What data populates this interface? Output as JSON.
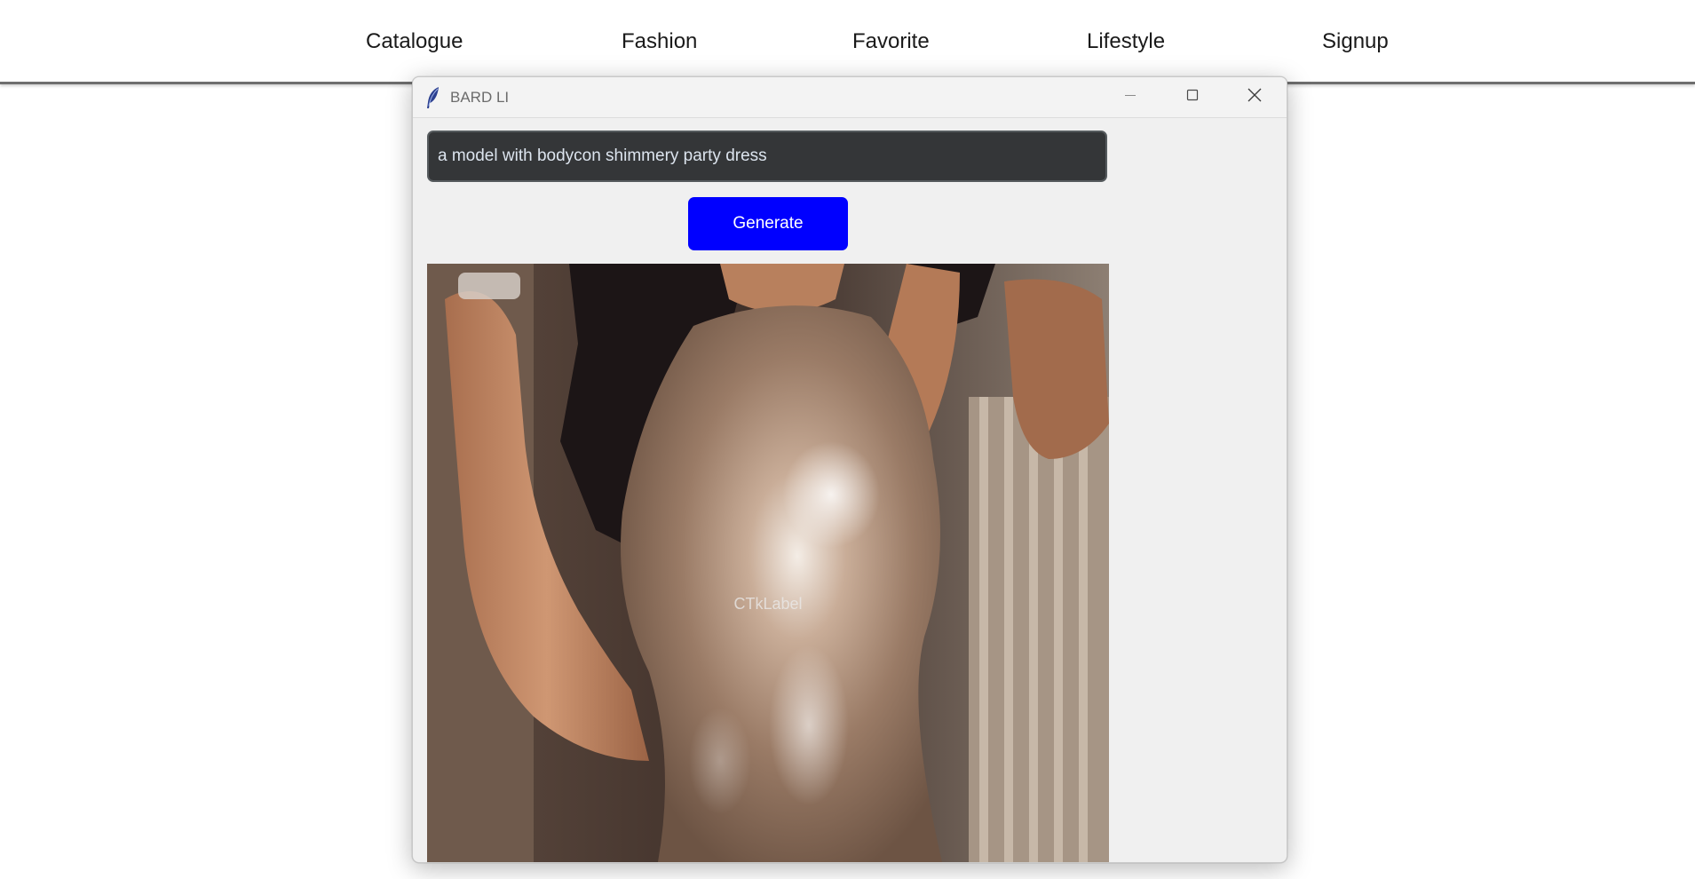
{
  "nav": {
    "items": [
      {
        "label": "Catalogue"
      },
      {
        "label": "Fashion"
      },
      {
        "label": "Favorite"
      },
      {
        "label": "Lifestyle"
      },
      {
        "label": "Signup"
      }
    ]
  },
  "window": {
    "title": "BARD LI",
    "icon": "feather-icon",
    "controls": [
      "minimize-icon",
      "maximize-icon",
      "close-icon"
    ]
  },
  "prompt": {
    "value": "a model with bodycon shimmery party dress"
  },
  "generate": {
    "label": "Generate",
    "color": "#0000ff"
  },
  "image": {
    "label": "CTkLabel"
  },
  "colors": {
    "input_background": "#343638",
    "window_background": "#f0f0f0",
    "button_accent": "#0000ff"
  }
}
